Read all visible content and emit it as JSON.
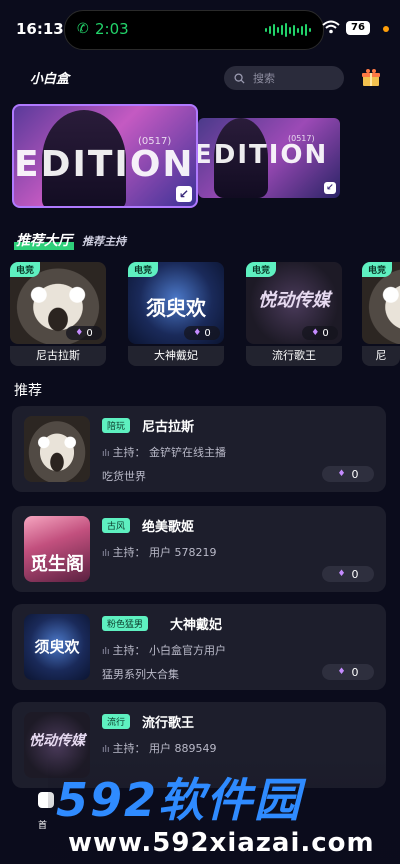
{
  "status_bar": {
    "time": "16:13",
    "call_time": "2:03",
    "battery": "76"
  },
  "appbar": {
    "logo": "小白盒",
    "search_placeholder": "搜索"
  },
  "banners": [
    {
      "title": "EDITION",
      "subtitle": "(0517)"
    },
    {
      "title": "EDITION",
      "subtitle": "(0517)"
    }
  ],
  "section": {
    "title": "推荐大厅",
    "subtitle": "推荐主持"
  },
  "hall": [
    {
      "tag": "电竞",
      "name": "尼古拉斯",
      "count": "0",
      "art": "husky"
    },
    {
      "tag": "电竞",
      "name": "大神戴妃",
      "count": "0",
      "art": "music",
      "art_text": "须臾欢"
    },
    {
      "tag": "电竞",
      "name": "流行歌王",
      "count": "0",
      "art": "yuedong",
      "art_text": "悦动传媒"
    },
    {
      "tag": "电竞",
      "name": "尼",
      "count": "",
      "art": "husky"
    }
  ],
  "recommend_title": "推荐",
  "list": [
    {
      "tag": "陪玩",
      "name": "尼古拉斯",
      "host": "主持：  金铲铲在线主播",
      "desc": "吃货世界",
      "count": "0",
      "art": "husky"
    },
    {
      "tag": "古风",
      "name": "绝美歌姬",
      "host": "主持：  用户 578219",
      "desc": "",
      "count": "0",
      "art": "girl",
      "art_text": "觅生阁"
    },
    {
      "tag": "粉色猛男",
      "name": "大神戴妃",
      "host": "主持：  小白盒官方用户",
      "desc": "猛男系列大合集",
      "count": "0",
      "art": "music",
      "art_text": "须臾欢"
    },
    {
      "tag": "流行",
      "name": "流行歌王",
      "host": "主持：  用户 889549",
      "desc": "",
      "count": "",
      "art": "yuedong",
      "art_text": "悦动传媒"
    }
  ],
  "bottom_nav": {
    "first_label": "首"
  },
  "watermark": {
    "big": "592软件园",
    "url": "www.592xiazai.com"
  },
  "colors": {
    "tag_green": "#5ef0c0",
    "accent_purple": "#c58cff",
    "background": "#0b0c1c",
    "card": "#1d1e2c"
  }
}
